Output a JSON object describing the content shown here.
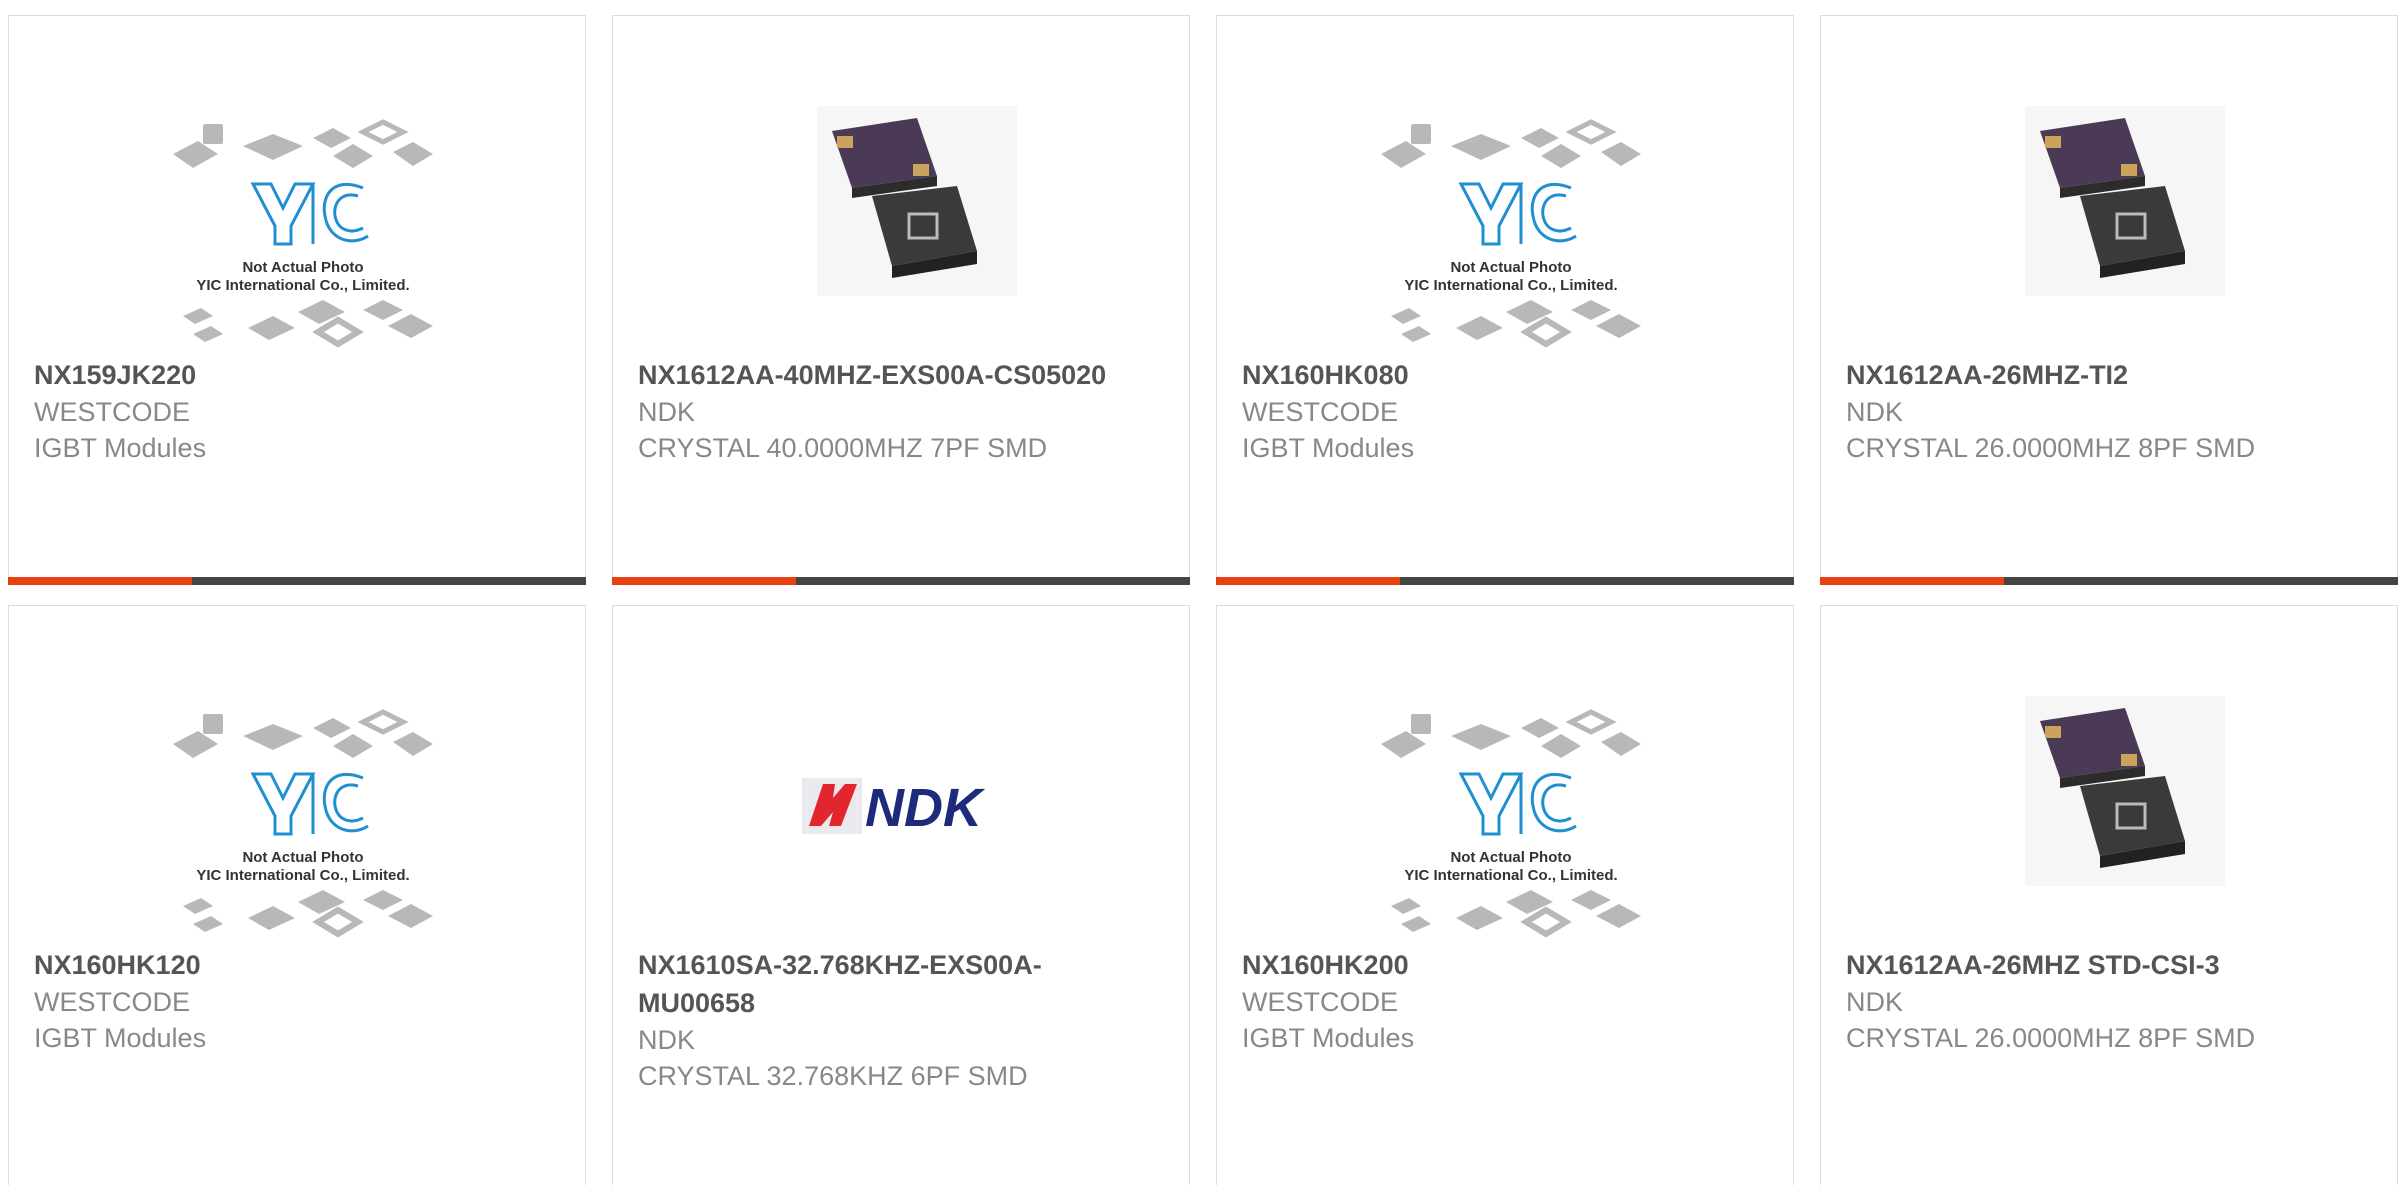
{
  "products": [
    {
      "part": "NX159JK220",
      "manufacturer": "WESTCODE",
      "description": "IGBT Modules",
      "image": "yic-placeholder",
      "placeholder_line1": "Not Actual Photo",
      "placeholder_line2": "YIC International Co., Limited."
    },
    {
      "part": "NX1612AA-40MHZ-EXS00A-CS05020",
      "manufacturer": "NDK",
      "description": "CRYSTAL 40.0000MHZ 7PF SMD",
      "image": "crystal-photo"
    },
    {
      "part": "NX160HK080",
      "manufacturer": "WESTCODE",
      "description": "IGBT Modules",
      "image": "yic-placeholder",
      "placeholder_line1": "Not Actual Photo",
      "placeholder_line2": "YIC International Co., Limited."
    },
    {
      "part": "NX1612AA-26MHZ-TI2",
      "manufacturer": "NDK",
      "description": "CRYSTAL 26.0000MHZ 8PF SMD",
      "image": "crystal-photo"
    },
    {
      "part": "NX160HK120",
      "manufacturer": "WESTCODE",
      "description": "IGBT Modules",
      "image": "yic-placeholder",
      "placeholder_line1": "Not Actual Photo",
      "placeholder_line2": "YIC International Co., Limited."
    },
    {
      "part": "NX1610SA-32.768KHZ-EXS00A-MU00658",
      "manufacturer": "NDK",
      "description": "CRYSTAL 32.768KHZ 6PF SMD",
      "image": "ndk-logo",
      "logo_text": "NDK"
    },
    {
      "part": "NX160HK200",
      "manufacturer": "WESTCODE",
      "description": "IGBT Modules",
      "image": "yic-placeholder",
      "placeholder_line1": "Not Actual Photo",
      "placeholder_line2": "YIC International Co., Limited."
    },
    {
      "part": "NX1612AA-26MHZ STD-CSI-3",
      "manufacturer": "NDK",
      "description": "CRYSTAL 26.0000MHZ 8PF SMD",
      "image": "crystal-photo"
    }
  ],
  "colors": {
    "accent": "#e8400f",
    "bar": "#444444",
    "yic_blue": "#1f8fd1",
    "ndk_red": "#e3262e",
    "ndk_navy": "#1d2b7a"
  }
}
